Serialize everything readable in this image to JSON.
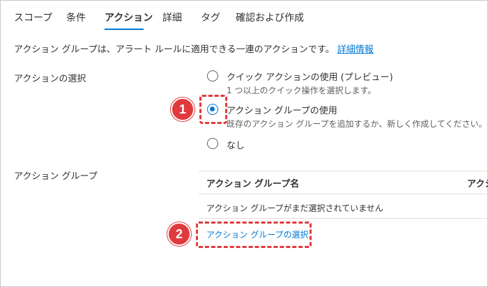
{
  "tabs": [
    {
      "label": "スコープ"
    },
    {
      "label": "条件"
    },
    {
      "label": "アクション"
    },
    {
      "label": "詳細"
    },
    {
      "label": "タグ"
    },
    {
      "label": "確認および作成"
    }
  ],
  "description": {
    "text": "アクション グループは、アラート ルールに適用できる一連のアクションです。",
    "link": "詳細情報"
  },
  "action_select": {
    "label": "アクションの選択",
    "options": [
      {
        "title": "クイック アクションの使用 (プレビュー)",
        "desc": "1 つ以上のクイック操作を選択します。",
        "checked": false
      },
      {
        "title": "アクション グループの使用",
        "desc": "既存のアクション グループを追加するか、新しく作成してください。",
        "checked": true
      },
      {
        "title": "なし",
        "desc": "",
        "checked": false
      }
    ]
  },
  "action_group": {
    "label": "アクション グループ",
    "columns": [
      "アクション グループ名",
      "アクシ"
    ],
    "empty_text": "アクション グループがまだ選択されていません",
    "select_link": "アクション グループの選択"
  },
  "callouts": [
    "1",
    "2"
  ],
  "colors": {
    "accent": "#0078d4",
    "callout": "#e03a3e"
  }
}
